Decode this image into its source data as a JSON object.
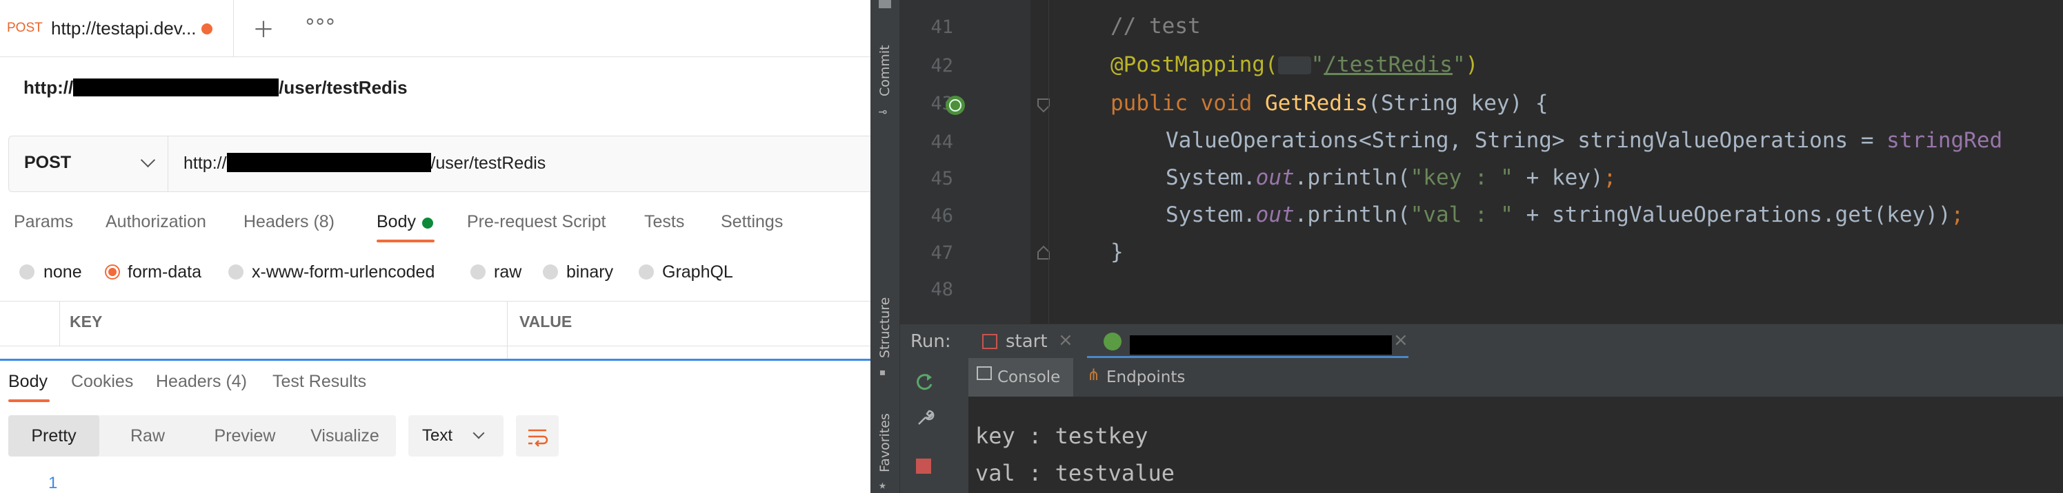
{
  "postman": {
    "tab": {
      "method": "POST",
      "title": "http://testapi.dev..."
    },
    "request_title": {
      "prefix": "http://",
      "suffix": "/user/testRedis"
    },
    "method": "POST",
    "url": {
      "prefix": "http://",
      "suffix": "/user/testRedis"
    },
    "request_tabs": [
      {
        "label": "Params"
      },
      {
        "label": "Authorization"
      },
      {
        "label": "Headers",
        "count": "(8)"
      },
      {
        "label": "Body"
      },
      {
        "label": "Pre-request Script"
      },
      {
        "label": "Tests"
      },
      {
        "label": "Settings"
      }
    ],
    "body_modes": [
      "none",
      "form-data",
      "x-www-form-urlencoded",
      "raw",
      "binary",
      "GraphQL"
    ],
    "selected_body_mode": "form-data",
    "table_headers": {
      "key": "KEY",
      "value": "VALUE"
    },
    "response_tabs": [
      {
        "label": "Body"
      },
      {
        "label": "Cookies"
      },
      {
        "label": "Headers",
        "count": "(4)"
      },
      {
        "label": "Test Results"
      }
    ],
    "view_modes": [
      "Pretty",
      "Raw",
      "Preview",
      "Visualize"
    ],
    "format": "Text",
    "first_line_number": "1",
    "colors": {
      "accent": "#f26b3a",
      "headers_count": "#0c8a3a",
      "body_dot": "#0c8a3a"
    }
  },
  "ide": {
    "side_labels": {
      "commit": "Commit",
      "structure": "Structure",
      "favorites": "Favorites"
    },
    "line_numbers": [
      "41",
      "42",
      "43",
      "44",
      "45",
      "46",
      "47",
      "48"
    ],
    "code": {
      "l41": "// test",
      "l42_ann": "@PostMapping(",
      "l42_str_open": "\"",
      "l42_path": "/testRedis",
      "l42_str_close": "\"",
      "l42_close": ")",
      "l43_public": "public ",
      "l43_void": "void ",
      "l43_fn": "GetRedis",
      "l43_rest": "(String key) {",
      "l44_a": "ValueOperations<String, String> stringValueOperations = ",
      "l44_b": "stringRed",
      "l45_a": "System.",
      "l45_out": "out",
      "l45_b": ".println(",
      "l45_str": "\"key : \"",
      "l45_c": " + key)",
      "l45_semi": ";",
      "l46_a": "System.",
      "l46_out": "out",
      "l46_b": ".println(",
      "l46_str": "\"val : \"",
      "l46_c": " + stringValueOperations.get(key))",
      "l46_semi": ";",
      "l47": "}"
    },
    "run": {
      "label": "Run:",
      "config_start": "start"
    },
    "subtabs": {
      "console": "Console",
      "endpoints": "Endpoints"
    },
    "console_lines": [
      "key : testkey",
      "val : testvalue"
    ],
    "colors": {
      "bg": "#2b2b2b",
      "keyword": "#cc7832",
      "string": "#6a8759",
      "function": "#ffc66d",
      "annotation": "#bbb529",
      "field": "#9876aa"
    }
  }
}
